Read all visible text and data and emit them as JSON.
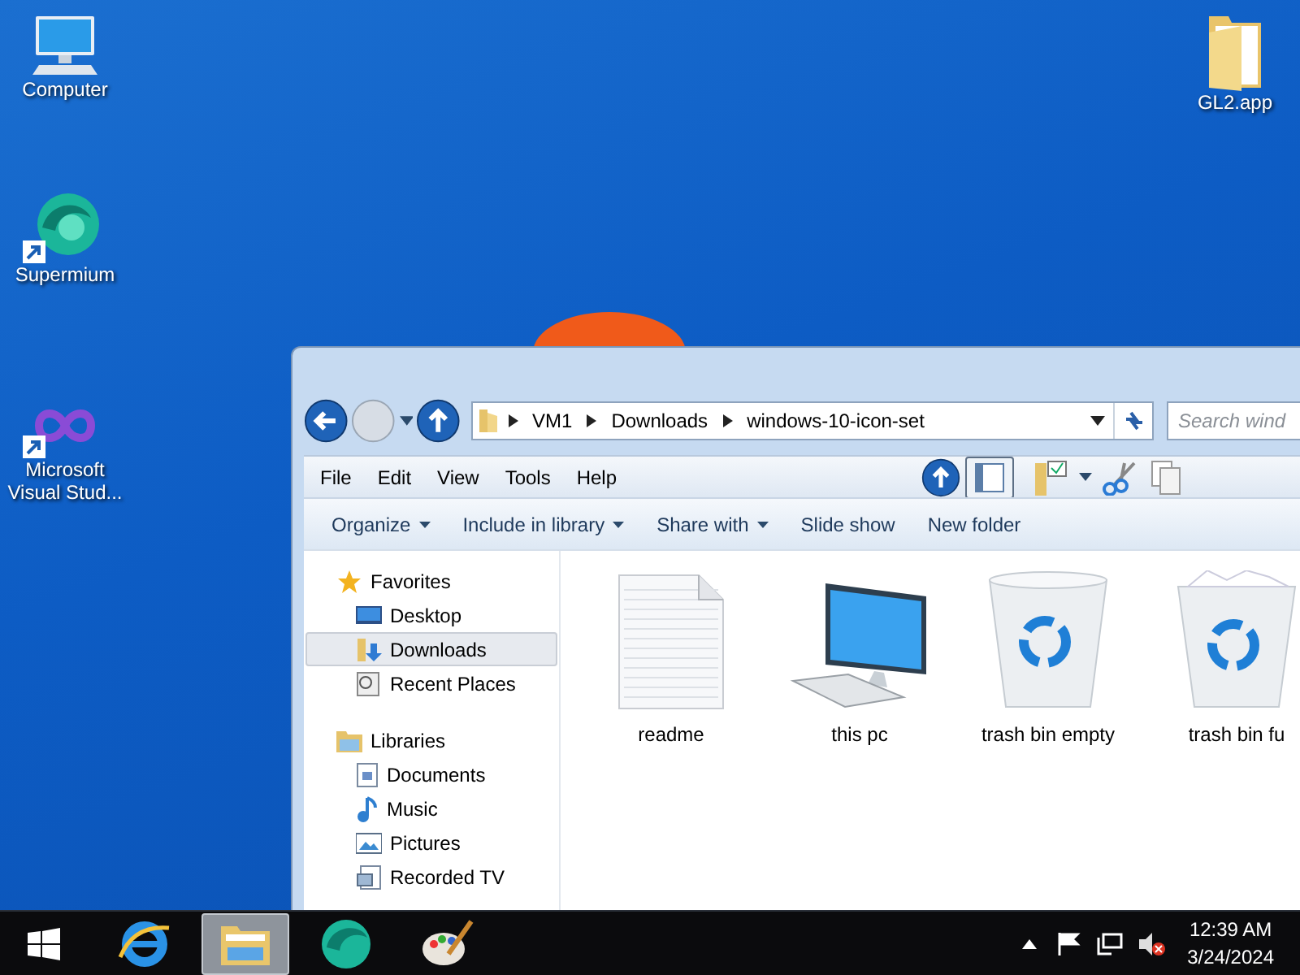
{
  "desktop_icons": [
    {
      "label": "Computer",
      "kind": "computer",
      "shortcut": false
    },
    {
      "label": "Supermium",
      "kind": "supermium",
      "shortcut": true
    },
    {
      "label": "Microsoft Visual Stud...",
      "kind": "vs",
      "shortcut": true
    },
    {
      "label": "GL2.app",
      "kind": "folder",
      "shortcut": false
    }
  ],
  "explorer": {
    "breadcrumbs": [
      "VM1",
      "Downloads",
      "windows-10-icon-set"
    ],
    "search": {
      "placeholder": "Search wind"
    },
    "menu": [
      "File",
      "Edit",
      "View",
      "Tools",
      "Help"
    ],
    "commands": [
      {
        "label": "Organize",
        "dropdown": true
      },
      {
        "label": "Include in library",
        "dropdown": true
      },
      {
        "label": "Share with",
        "dropdown": true
      },
      {
        "label": "Slide show",
        "dropdown": false
      },
      {
        "label": "New folder",
        "dropdown": false
      }
    ],
    "navigation": [
      {
        "label": "Favorites",
        "kind": "star",
        "children": [
          {
            "label": "Desktop",
            "kind": "desktop",
            "selected": false
          },
          {
            "label": "Downloads",
            "kind": "downloads",
            "selected": true
          },
          {
            "label": "Recent Places",
            "kind": "recent",
            "selected": false
          }
        ]
      },
      {
        "label": "Libraries",
        "kind": "libraries",
        "children": [
          {
            "label": "Documents",
            "kind": "documents",
            "selected": false
          },
          {
            "label": "Music",
            "kind": "music",
            "selected": false
          },
          {
            "label": "Pictures",
            "kind": "pictures",
            "selected": false
          },
          {
            "label": "Recorded TV",
            "kind": "tv",
            "selected": false
          }
        ]
      }
    ],
    "files": [
      {
        "name": "readme",
        "kind": "text"
      },
      {
        "name": "this pc",
        "kind": "pc"
      },
      {
        "name": "trash bin empty",
        "kind": "bin-empty"
      },
      {
        "name": "trash bin fu",
        "kind": "bin-full"
      }
    ]
  },
  "taskbar": {
    "apps": [
      {
        "kind": "ie",
        "selected": false
      },
      {
        "kind": "explorer",
        "selected": true
      },
      {
        "kind": "supermium",
        "selected": false
      },
      {
        "kind": "paint",
        "selected": false
      }
    ],
    "clock": {
      "time": "12:39 AM",
      "date": "3/24/2024"
    }
  }
}
